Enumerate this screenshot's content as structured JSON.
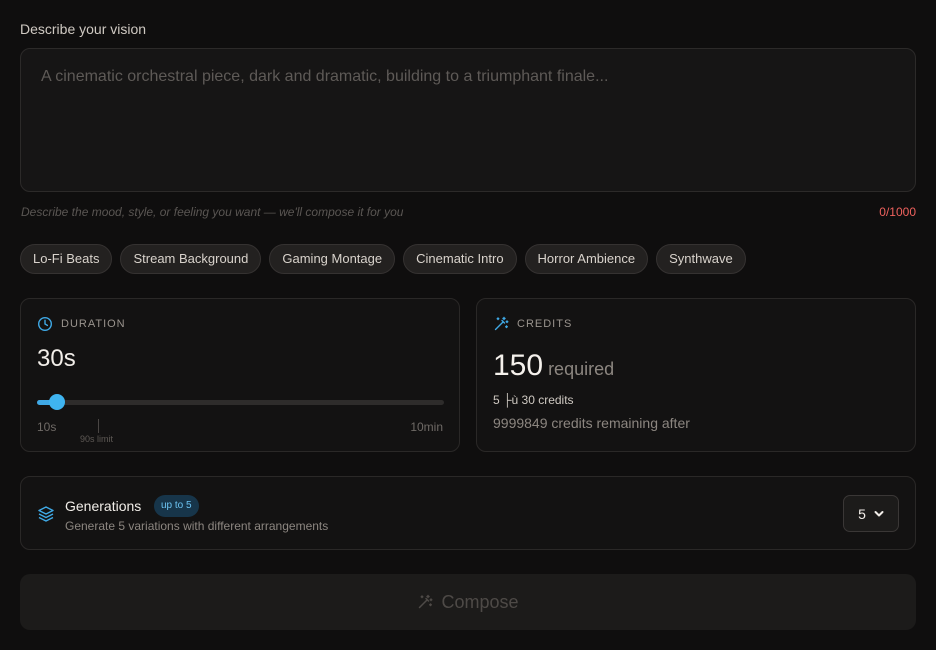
{
  "vision": {
    "label": "Describe your vision",
    "placeholder": "A cinematic orchestral piece, dark and dramatic, building to a triumphant finale...",
    "value": "",
    "hint": "Describe the mood, style, or feeling you want — we'll compose it for you",
    "counter": "0/1000"
  },
  "presets": [
    "Lo-Fi Beats",
    "Stream Background",
    "Gaming Montage",
    "Cinematic Intro",
    "Horror Ambience",
    "Synthwave"
  ],
  "duration": {
    "heading": "DURATION",
    "icon": "clock-icon",
    "value_label": "30s",
    "level_percent": 5,
    "min_label": "10s",
    "max_label": "10min",
    "limit_label": "90s limit"
  },
  "credits": {
    "heading": "CREDITS",
    "icon": "magic-wand-icon",
    "required_value": "150",
    "required_label": "required",
    "calc": "5 ├ù 30 credits",
    "remaining": "9999849 credits remaining after"
  },
  "generations": {
    "icon": "layers-icon",
    "title": "Generations",
    "badge": "up to 5",
    "description": "Generate 5 variations with different arrangements",
    "selected": "5"
  },
  "compose": {
    "icon": "magic-wand-icon",
    "label": "Compose"
  },
  "colors": {
    "accent": "#3fb4f0",
    "background": "#0f0e0e",
    "counter_warning": "#f0625e"
  }
}
